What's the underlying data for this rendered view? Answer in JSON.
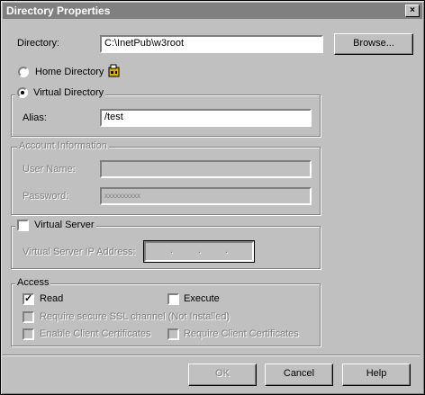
{
  "window": {
    "title": "Directory Properties",
    "close_glyph": "×"
  },
  "directory": {
    "label": "Directory:",
    "value": "C:\\InetPub\\w3root",
    "browse_label": "Browse..."
  },
  "home_directory": {
    "label": "Home Directory",
    "selected": false
  },
  "virtual_directory": {
    "label": "Virtual Directory",
    "selected": true,
    "alias_label": "Alias:",
    "alias_value": "/test"
  },
  "account": {
    "title": "Account Information",
    "user_label": "User Name:",
    "user_value": "",
    "password_label": "Password:",
    "password_value": "xxxxxxxxxx"
  },
  "virtual_server": {
    "label": "Virtual Server",
    "checked": false,
    "ip_label": "Virtual Server IP Address:",
    "ip_dot": "."
  },
  "access": {
    "title": "Access",
    "read_label": "Read",
    "read_checked": true,
    "execute_label": "Execute",
    "execute_checked": false,
    "ssl_label": "Require secure SSL channel (Not Installed)",
    "client_certs_label": "Enable Client Certificates",
    "require_client_certs_label": "Require Client Certificates"
  },
  "buttons": {
    "ok": "OK",
    "cancel": "Cancel",
    "help": "Help"
  },
  "check_glyph": "✓"
}
